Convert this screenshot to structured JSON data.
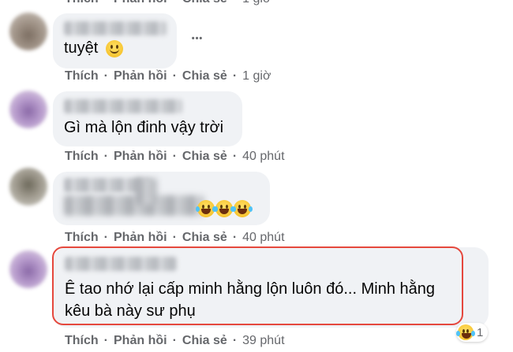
{
  "actions": {
    "like": "Thích",
    "reply": "Phản hồi",
    "share": "Chia sẻ",
    "separator": "·"
  },
  "more_label": "•••",
  "comments": [
    {
      "text": "",
      "time": "1 giờ"
    },
    {
      "text": "tuyệt",
      "emoji": "smile-emoji",
      "time": "1 giờ"
    },
    {
      "text": "Gì mà lộn đinh vậy trời",
      "time": "40 phút"
    },
    {
      "text": "",
      "emoji": "laughing-emoji",
      "time": "40 phút"
    },
    {
      "text_line1": "Ê tao nhớ lại cấp minh hằng lộn luôn đó... Minh hằng",
      "text_line2": "kêu bà này sư phụ",
      "time": "39 phút",
      "reaction_count": "1"
    }
  ],
  "colors": {
    "bubble": "#f0f2f5",
    "action_text": "#65676b",
    "highlight": "#e5483d"
  }
}
